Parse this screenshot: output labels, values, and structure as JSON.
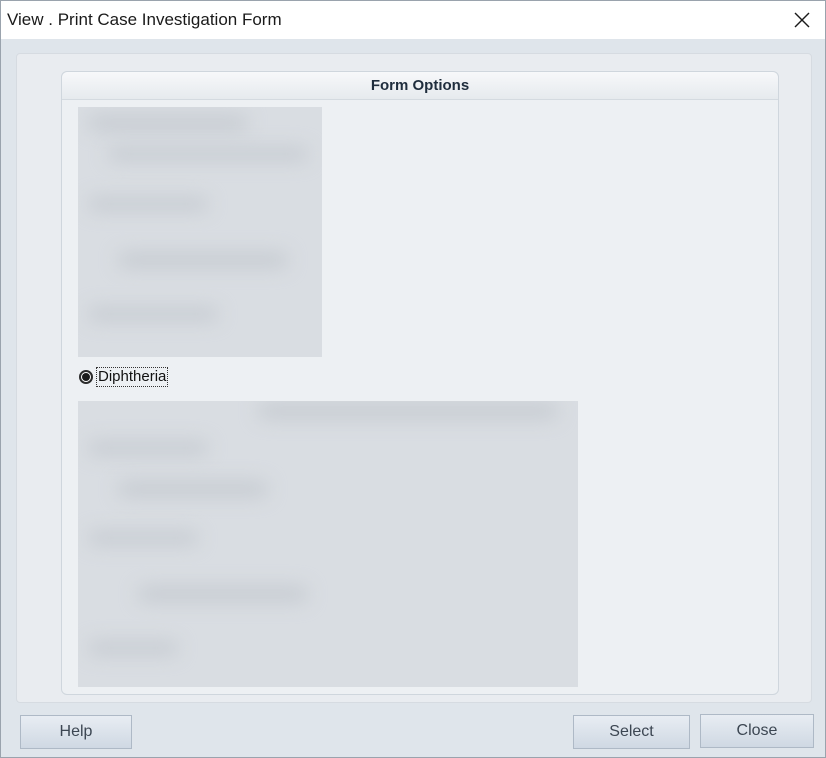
{
  "window": {
    "title": "View . Print Case Investigation Form",
    "close_icon": "close-icon"
  },
  "form_options": {
    "header": "Form Options",
    "selected_option": {
      "label": "Diphtheria",
      "checked": true
    }
  },
  "buttons": {
    "help": "Help",
    "select": "Select",
    "close": "Close"
  },
  "colors": {
    "client_background": "#dfe5eb",
    "panel_background": "#edf0f3",
    "button_gradient_top": "#e8edf3",
    "button_gradient_bottom": "#cfd8e3"
  }
}
